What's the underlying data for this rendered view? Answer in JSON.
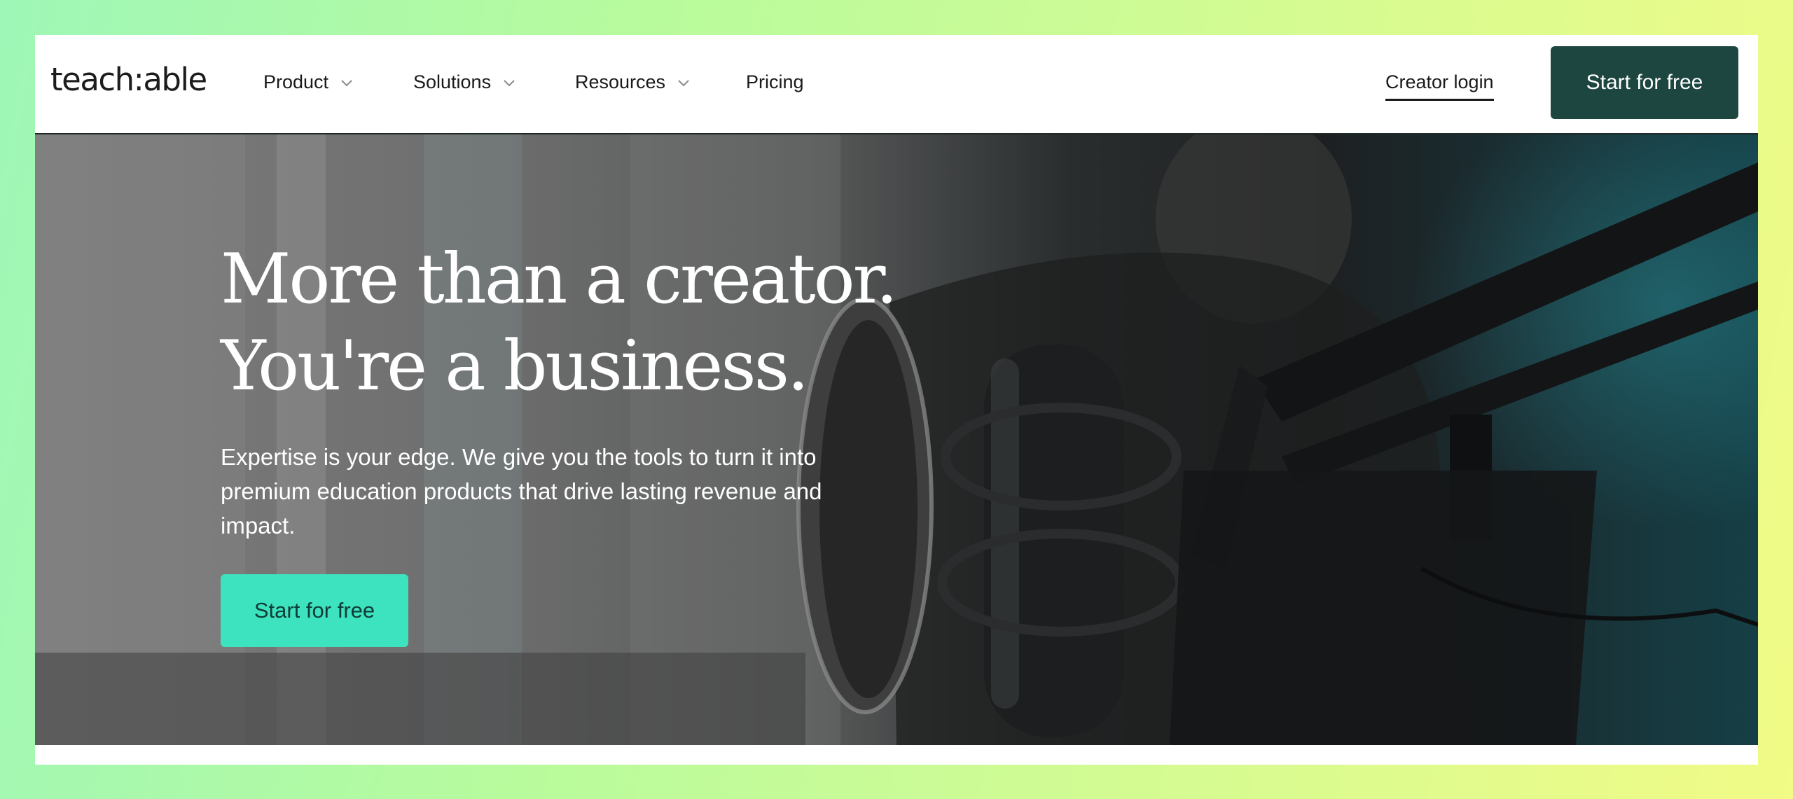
{
  "brand": {
    "logo_text": "teach:able"
  },
  "nav": {
    "items": [
      {
        "label": "Product",
        "has_dropdown": true
      },
      {
        "label": "Solutions",
        "has_dropdown": true
      },
      {
        "label": "Resources",
        "has_dropdown": true
      },
      {
        "label": "Pricing",
        "has_dropdown": false
      }
    ],
    "creator_login": "Creator login",
    "cta_label": "Start for free",
    "dropdown_icon": "chevron-down-icon"
  },
  "hero": {
    "title_line1": "More than a creator.",
    "title_line2": "You're a business.",
    "subtitle": "Expertise is your edge. We give you the tools to turn it into premium education products that drive lasting revenue and impact.",
    "cta_label": "Start for free",
    "background_image": "podcast microphone with pop filter"
  },
  "colors": {
    "nav_cta_bg": "#1d4640",
    "hero_cta_bg": "#3de3be",
    "page_gradient_start": "#9ef7b7",
    "page_gradient_end": "#f1fb86"
  }
}
